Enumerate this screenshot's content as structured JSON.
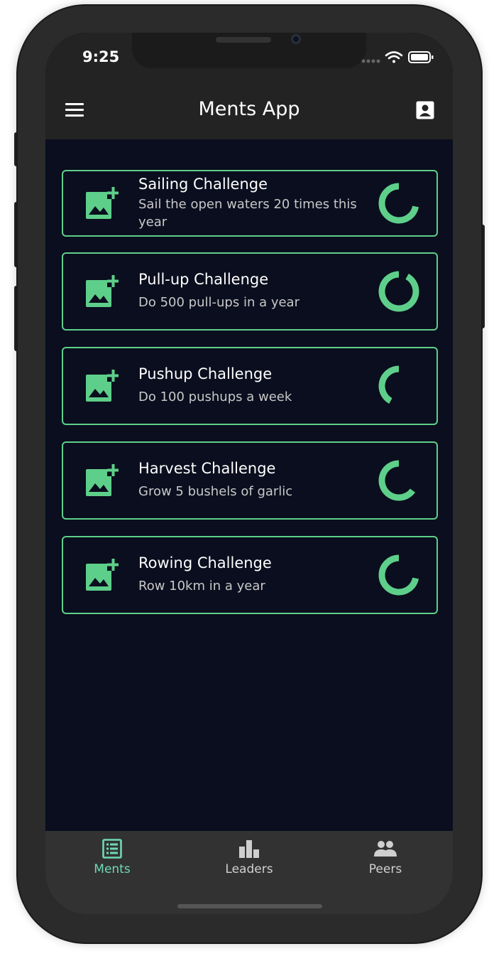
{
  "status_bar": {
    "time": "9:25"
  },
  "app_bar": {
    "title": "Ments App",
    "menu_icon": "hamburger-menu-icon",
    "profile_icon": "account-box-icon"
  },
  "challenges": [
    {
      "title": "Sailing Challenge",
      "description": "Sail the open waters 20 times this year",
      "icon": "add-photo-icon",
      "progress": 0.72
    },
    {
      "title": "Pull-up Challenge",
      "description": "Do 500 pull-ups in a year",
      "icon": "add-photo-icon",
      "progress": 0.92
    },
    {
      "title": "Pushup Challenge",
      "description": "Do 100 pushups a week",
      "icon": "add-photo-icon",
      "progress": 0.42
    },
    {
      "title": "Harvest Challenge",
      "description": "Grow 5 bushels of garlic",
      "icon": "add-photo-icon",
      "progress": 0.65
    },
    {
      "title": "Rowing Challenge",
      "description": "Row 10km in a year",
      "icon": "add-photo-icon",
      "progress": 0.72
    }
  ],
  "bottom_nav": [
    {
      "label": "Ments",
      "icon": "list-icon",
      "active": true
    },
    {
      "label": "Leaders",
      "icon": "bar-chart-icon",
      "active": false
    },
    {
      "label": "Peers",
      "icon": "people-icon",
      "active": false
    }
  ],
  "colors": {
    "accent": "#5ecf8a",
    "background": "#0a0e1e",
    "appbar": "#232323",
    "nav_active": "#6fd9b3",
    "nav_bar": "#323232"
  }
}
